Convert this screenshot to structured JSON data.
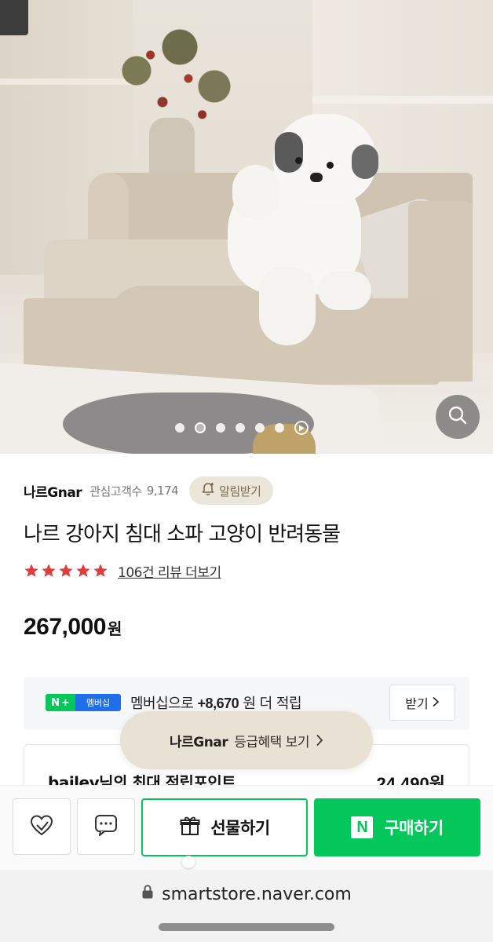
{
  "hero": {
    "image_alt": "",
    "carousel_count": 7,
    "active_slide": 2
  },
  "store": {
    "name": "나르Gnar",
    "followers_label": "관심고객수",
    "followers_count": "9,174",
    "alert_label": "알림받기"
  },
  "product": {
    "title": "나르 강아지 침대 소파 고양이 반려동물",
    "rating_stars": 5,
    "review_link": "106건 리뷰 더보기",
    "price": "267,000",
    "currency": "원"
  },
  "membership": {
    "badge_n": "N",
    "badge_plus": "+",
    "badge_label": "멤버십",
    "text_prefix": "멤버십으로",
    "amount": "+8,670",
    "text_suffix": "원 더 적립",
    "receive_label": "받기"
  },
  "points": {
    "label": "bailey님의 최대 적립포인트",
    "value": "24,490원"
  },
  "grade_pill": {
    "store": "나르Gnar",
    "label": "등급혜택 보기"
  },
  "bottom_bar": {
    "gift_label": "선물하기",
    "buy_label": "구매하기",
    "buy_logo": "N"
  },
  "browser": {
    "url": "smartstore.naver.com"
  },
  "colors": {
    "naver_green": "#03c75a",
    "star_red": "#e03e3e",
    "alert_bg": "#ece5da",
    "membership_blue": "#1f6feb"
  },
  "icons": [
    "search-icon",
    "play-icon",
    "bell-plus-icon",
    "star-icon",
    "chevron-right-icon",
    "heart-icon",
    "chat-icon",
    "gift-icon",
    "lock-icon"
  ]
}
